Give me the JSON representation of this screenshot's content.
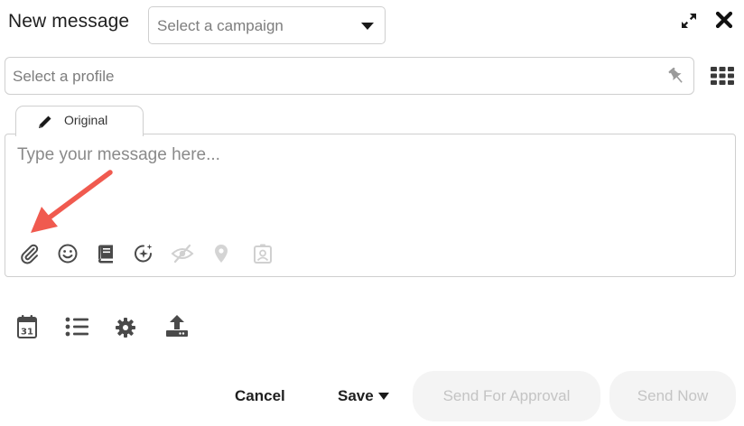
{
  "header": {
    "title": "New message",
    "campaign_select": {
      "placeholder": "Select a campaign"
    }
  },
  "profile": {
    "placeholder": "Select a profile"
  },
  "editor": {
    "tab_label": "Original",
    "placeholder": "Type your message here...",
    "toolbar_icons": [
      "paperclip-icon",
      "smiley-icon",
      "book-icon",
      "sparkle-icon",
      "eye-slash-icon",
      "map-pin-icon",
      "contact-card-icon"
    ]
  },
  "bottom_toolbar": {
    "calendar_day": "31",
    "icons": [
      "calendar-icon",
      "list-icon",
      "gear-icon",
      "upload-icon"
    ]
  },
  "footer": {
    "cancel_label": "Cancel",
    "save_label": "Save",
    "send_for_approval_label": "Send For Approval",
    "send_now_label": "Send Now"
  },
  "colors": {
    "annotation_arrow": "#f05a4f",
    "icon_dark": "#4a4a4a",
    "icon_disabled": "#d0d0d0",
    "disabled_button_bg": "#f4f4f4",
    "disabled_button_text": "#c4c4c4"
  }
}
